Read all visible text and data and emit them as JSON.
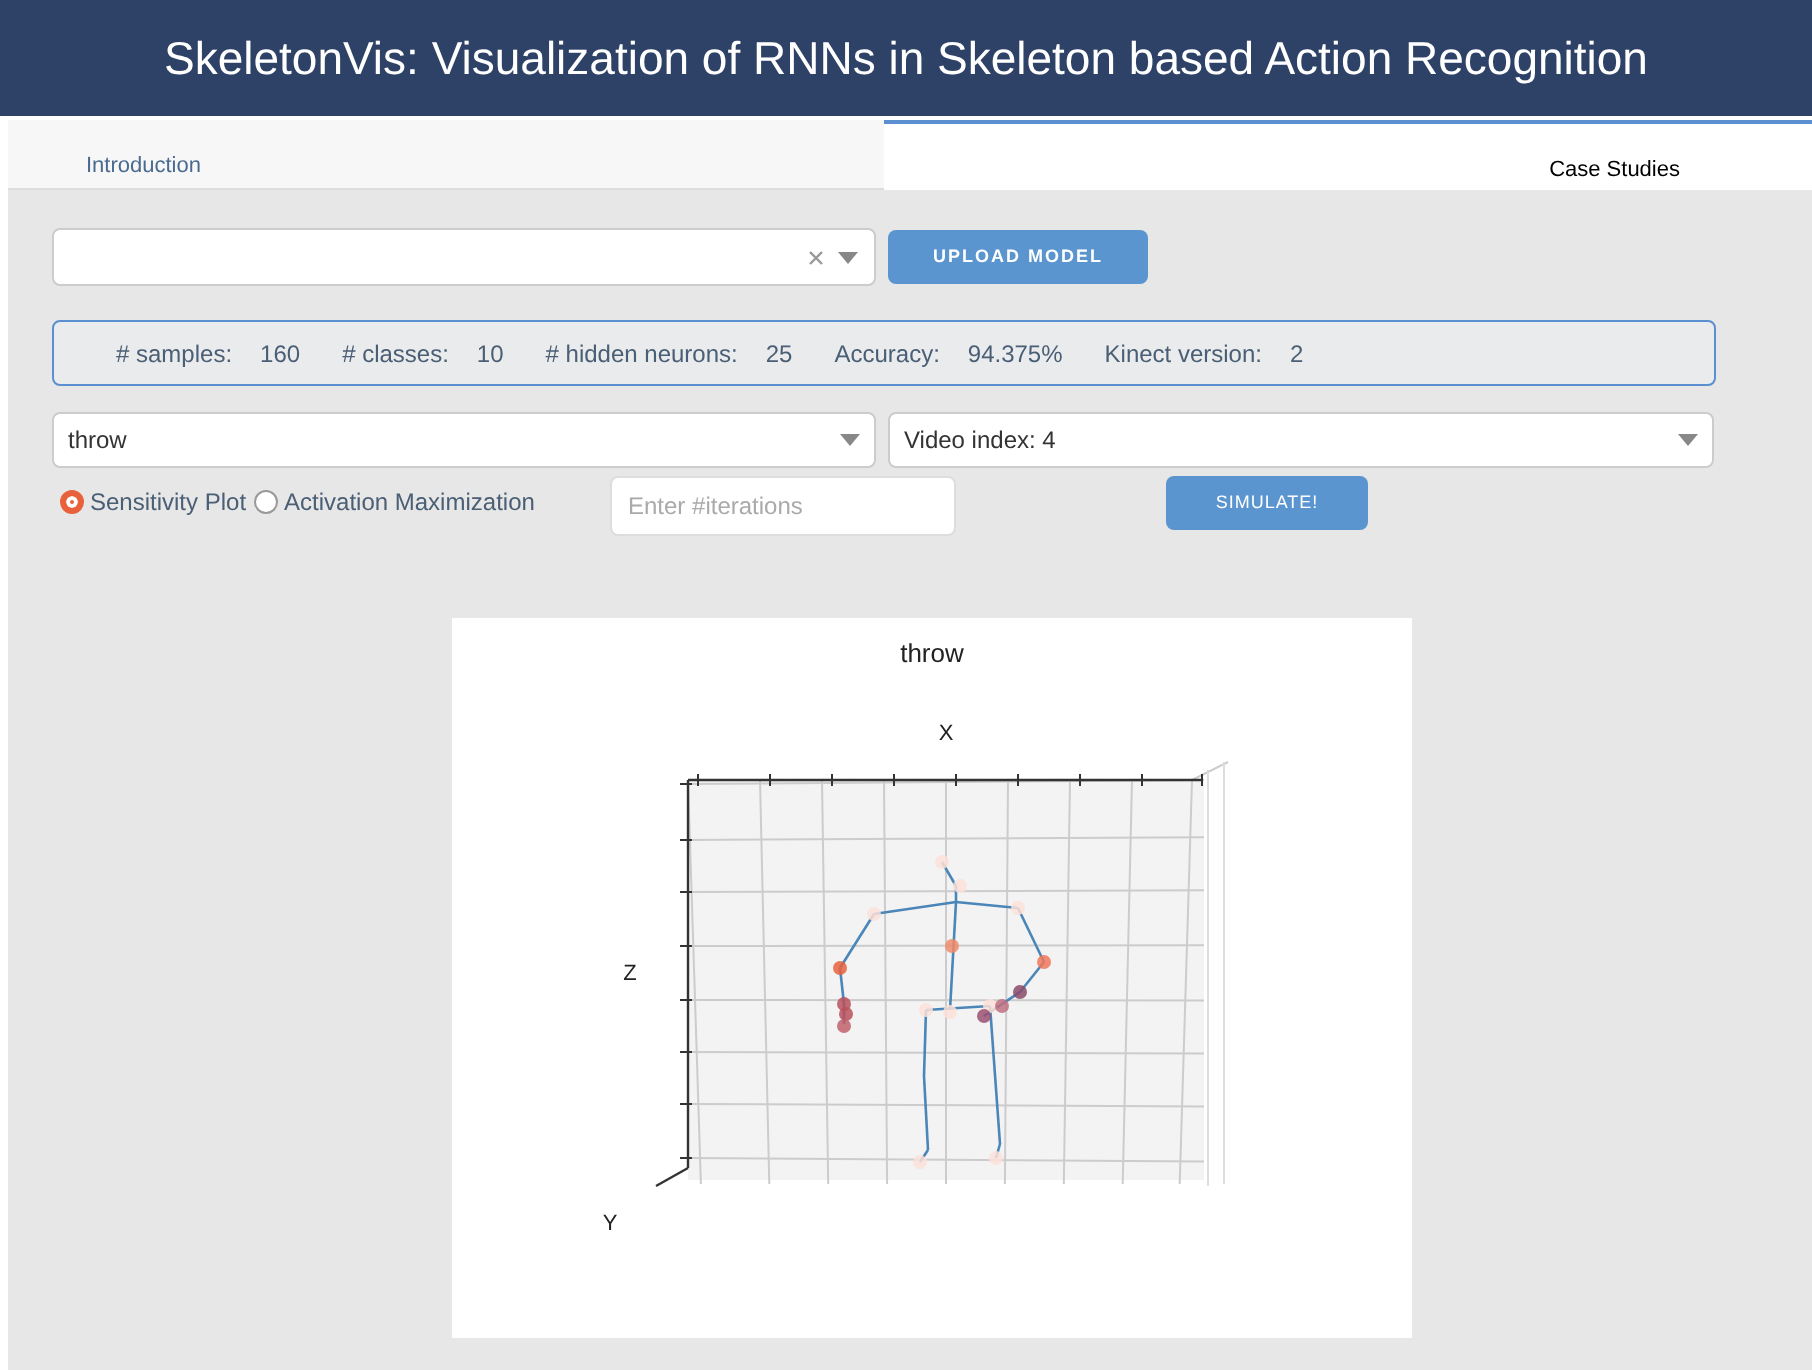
{
  "header": {
    "title": "SkeletonVis: Visualization of RNNs in Skeleton based Action Recognition"
  },
  "tabs": [
    {
      "label": "Introduction",
      "selected": false
    },
    {
      "label": "Case Studies",
      "selected": true
    }
  ],
  "upload_button": "UPLOAD MODEL",
  "stats": [
    {
      "label": "# samples:",
      "value": "160"
    },
    {
      "label": "# classes:",
      "value": "10"
    },
    {
      "label": "# hidden neurons:",
      "value": "25"
    },
    {
      "label": "Accuracy:",
      "value": "94.375%"
    },
    {
      "label": "Kinect version:",
      "value": "2"
    }
  ],
  "class_select": {
    "value": "throw"
  },
  "video_select": {
    "value": "Video index: 4"
  },
  "modes": [
    {
      "label": "Sensitivity Plot",
      "selected": true
    },
    {
      "label": "Activation Maximization",
      "selected": false
    }
  ],
  "iterations_field": {
    "placeholder": "Enter #iterations"
  },
  "simulate_button": "SIMULATE!",
  "plot": {
    "title": "throw",
    "x_label": "X",
    "z_label": "Z",
    "y_label": "Y"
  }
}
